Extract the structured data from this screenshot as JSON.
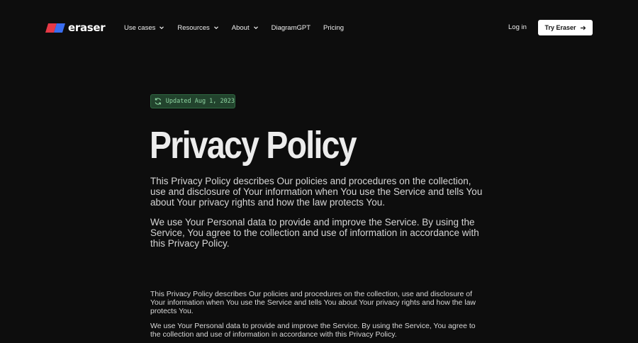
{
  "brand": {
    "name": "eraser",
    "colors": {
      "mark_red": "#e63946",
      "mark_blue": "#3a6df0",
      "background": "#0d0d0d",
      "badge_bg": "#22432d",
      "badge_text": "#8fd6a2"
    }
  },
  "nav": {
    "items": [
      {
        "label": "Use cases",
        "has_dropdown": true,
        "icon": "chevron-down-icon"
      },
      {
        "label": "Resources",
        "has_dropdown": true,
        "icon": "chevron-down-icon"
      },
      {
        "label": "About",
        "has_dropdown": true,
        "icon": "chevron-down-icon"
      },
      {
        "label": "DiagramGPT",
        "has_dropdown": false
      },
      {
        "label": "Pricing",
        "has_dropdown": false
      }
    ],
    "login_label": "Log in",
    "cta_label": "Try Eraser",
    "cta_icon": "arrow-right-icon"
  },
  "badge": {
    "icon": "refresh-icon",
    "text": "Updated Aug 1, 2023"
  },
  "page": {
    "title": "Privacy Policy",
    "lead_paragraphs": [
      "This Privacy Policy describes Our policies and procedures on the collection, use and disclosure of Your information when You use the Service and tells You about Your privacy rights and how the law protects You.",
      "We use Your Personal data to provide and improve the Service. By using the Service, You agree to the collection and use of information in accordance with this Privacy Policy."
    ],
    "body_paragraphs": [
      "This Privacy Policy describes Our policies and procedures on the collection, use and disclosure of Your information when You use the Service and tells You about Your privacy rights and how the law protects You.",
      "We use Your Personal data to provide and improve the Service. By using the Service, You agree to the collection and use of information in accordance with this Privacy Policy."
    ]
  }
}
